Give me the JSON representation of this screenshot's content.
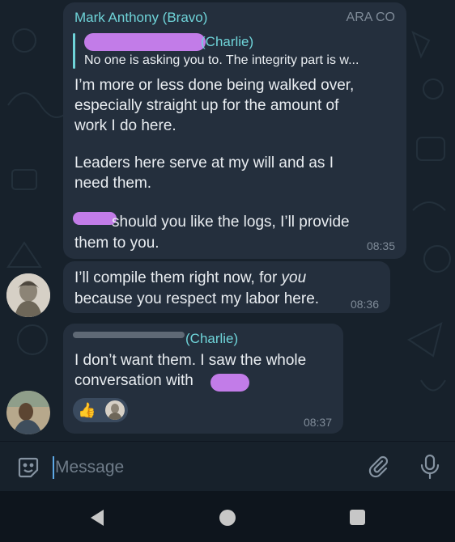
{
  "messages": [
    {
      "sender": "Mark Anthony (Bravo)",
      "badge": "ARA CO",
      "reply": {
        "sender_suffix": "(Charlie)",
        "preview": "No one is asking you to. The integrity part is w..."
      },
      "text_p1": "I’m more or less done being walked over,\nespecially straight up for the amount of\nwork I do here.",
      "text_p2": "Leaders here serve at my will and as I\nneed them.",
      "text_p3_after_redaction": "should you like the logs, I’ll provide",
      "text_p3_line2": "them to you.",
      "time": "08:35"
    },
    {
      "text_line1_prefix": "I’ll compile them right now, for ",
      "text_line1_emphasis": "you",
      "text_line2": "because you respect my labor here.",
      "time": "08:36"
    },
    {
      "sender_suffix": "(Charlie)",
      "text_line1": "I don’t want them. I saw the whole",
      "text_line2": "conversation with",
      "reactions": [
        "thumbs-up",
        "avatar"
      ],
      "time": "08:37"
    }
  ],
  "input": {
    "placeholder": "Message"
  },
  "colors": {
    "chat_background": "#17212b",
    "bubble": "#242f3d",
    "accent": "#6fd4d9",
    "meta_text": "#7f8b98",
    "redaction": "#c27ce8"
  }
}
